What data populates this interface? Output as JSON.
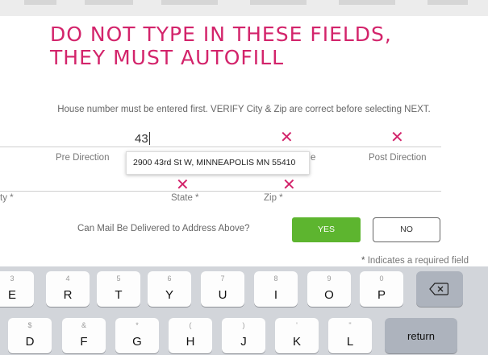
{
  "heading": {
    "line1": "DO NOT TYPE IN THESE FIELDS,",
    "line2": "THEY MUST AUTOFILL"
  },
  "instruction": "House number must be entered first. VERIFY City & Zip are correct before selecting NEXT.",
  "address_form": {
    "house_number_value": "43",
    "pre_direction_label": "Pre Direction",
    "street_type_label_partial": "e",
    "post_direction_label": "Post Direction",
    "city_label_partial": "ty *",
    "state_label": "State *",
    "zip_label": "Zip *",
    "autofill_suggestion": "2900 43rd St W, MINNEAPOLIS MN 55410"
  },
  "mail_delivery": {
    "question": "Can Mail Be Delivered to Address Above?",
    "yes_label": "YES",
    "no_label": "NO"
  },
  "required_note": {
    "star": "*",
    "text": "Indicates a required field"
  },
  "colors": {
    "accent_pink": "#d3246b",
    "yes_green": "#5db52f",
    "keyboard_bg": "#d2d5da"
  },
  "keyboard": {
    "row1": [
      {
        "alt": "3",
        "main": "E"
      },
      {
        "alt": "4",
        "main": "R"
      },
      {
        "alt": "5",
        "main": "T"
      },
      {
        "alt": "6",
        "main": "Y"
      },
      {
        "alt": "7",
        "main": "U"
      },
      {
        "alt": "8",
        "main": "I"
      },
      {
        "alt": "9",
        "main": "O"
      },
      {
        "alt": "0",
        "main": "P"
      }
    ],
    "row2": [
      {
        "alt": "$",
        "main": "D"
      },
      {
        "alt": "&",
        "main": "F"
      },
      {
        "alt": "*",
        "main": "G"
      },
      {
        "alt": "(",
        "main": "H"
      },
      {
        "alt": ")",
        "main": "J"
      },
      {
        "alt": "'",
        "main": "K"
      },
      {
        "alt": "\"",
        "main": "L"
      }
    ],
    "return_label": "return",
    "backspace_icon": "backspace-icon"
  }
}
